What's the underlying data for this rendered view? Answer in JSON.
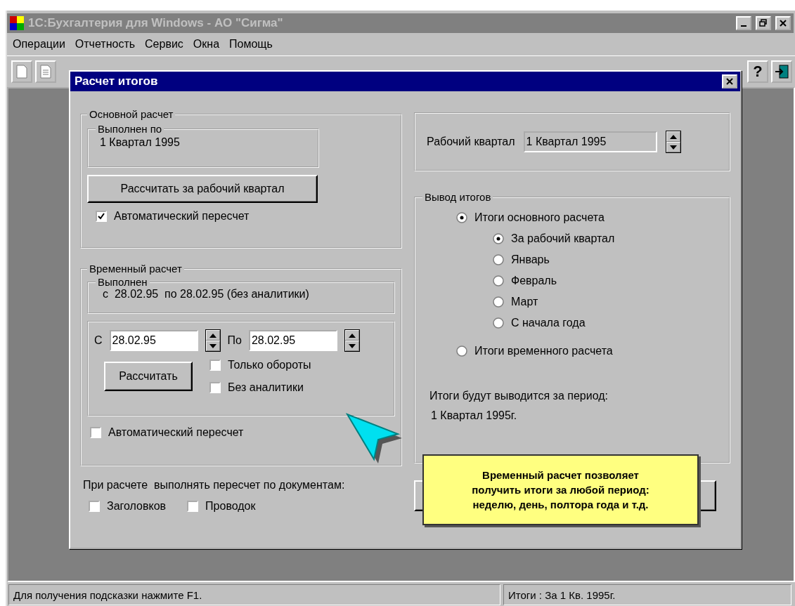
{
  "app": {
    "title": "1С:Бухгалтерия для Windows - АО \"Сигма\""
  },
  "menu": [
    {
      "label": "Операции"
    },
    {
      "label": "Отчетность"
    },
    {
      "label": "Сервис"
    },
    {
      "label": "Окна"
    },
    {
      "label": "Помощь"
    }
  ],
  "toolbar": {
    "help": "?"
  },
  "dialog": {
    "title": "Расчет итогов",
    "main_calc": {
      "title": "Основной расчет",
      "done_label": "Выполнен по",
      "done_value": "1 Квартал 1995",
      "button": "Рассчитать за рабочий квартал",
      "auto": {
        "label": "Автоматический пересчет",
        "checked": true
      }
    },
    "temp_calc": {
      "title": "Временный расчет",
      "done_label": "Выполнен",
      "done_value": "с  28.02.95  по 28.02.95 (без аналитики)",
      "from_label": "С",
      "from_value": "28.02.95",
      "to_label": "По",
      "to_value": "28.02.95",
      "button": "Рассчитать",
      "options": [
        {
          "label": "Только обороты",
          "checked": false
        },
        {
          "label": "Без аналитики",
          "checked": false
        }
      ],
      "auto": {
        "label": "Автоматический пересчет",
        "checked": false
      }
    },
    "recalc": {
      "label": "При расчете  выполнять пересчет по документам:",
      "options": [
        {
          "label": "Заголовков",
          "checked": false
        },
        {
          "label": "Проводок",
          "checked": false
        }
      ]
    },
    "quarter": {
      "label": "Рабочий квартал",
      "value": "1 Квартал 1995"
    },
    "output": {
      "title": "Вывод итогов",
      "options": [
        {
          "label": "Итоги основного расчета",
          "selected": true,
          "children": [
            {
              "label": "За рабочий квартал",
              "selected": true
            },
            {
              "label": "Январь",
              "selected": false
            },
            {
              "label": "Февраль",
              "selected": false
            },
            {
              "label": "Март",
              "selected": false
            },
            {
              "label": "С начала года",
              "selected": false
            }
          ]
        },
        {
          "label": "Итоги временного расчета",
          "selected": false
        }
      ],
      "period_label": "Итоги будут выводится за период:",
      "period_value": "1 Квартал 1995г."
    },
    "tooltip": {
      "lines": [
        "Временный расчет позволяет",
        "получить итоги за любой период:",
        "неделю, день, полтора года и т.д."
      ]
    }
  },
  "status_bar": [
    "Для получения подсказки нажмите F1.",
    "Итоги : За  1 Кв. 1995г."
  ]
}
